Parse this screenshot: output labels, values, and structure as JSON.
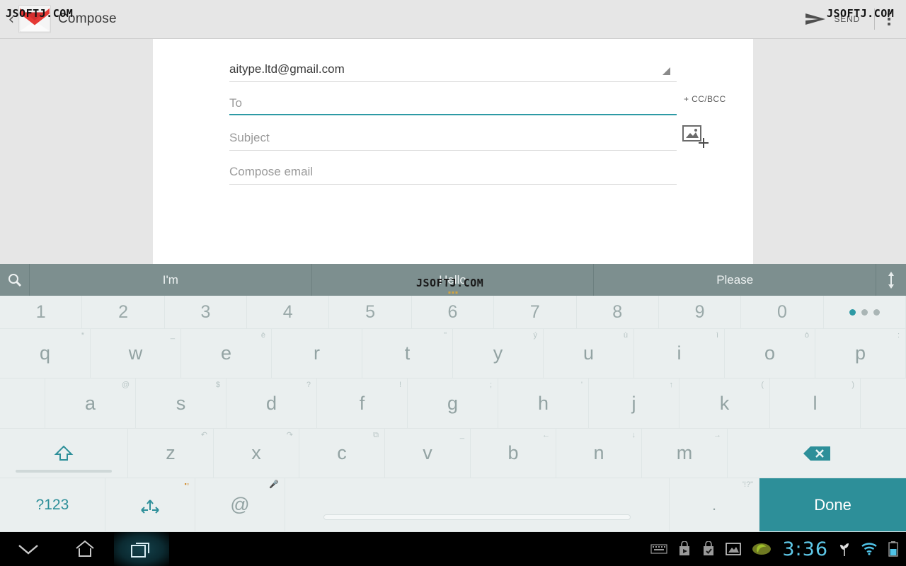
{
  "appbar": {
    "back_icon": "back-chevron-icon",
    "app_icon": "gmail-envelope-icon",
    "title": "Compose",
    "send_icon": "send-paper-plane-icon",
    "send_label": "SEND",
    "overflow_icon": "overflow-menu-icon"
  },
  "compose": {
    "from_value": "aitype.ltd@gmail.com",
    "from_dropdown_icon": "dropdown-caret-icon",
    "to_placeholder": "To",
    "cc_bcc_label": "+ CC/BCC",
    "subject_placeholder": "Subject",
    "body_placeholder": "Compose email",
    "attach_image_icon": "add-image-icon",
    "focus_color": "#2d9aa5"
  },
  "keyboard": {
    "suggestions": {
      "search_icon": "search-icon",
      "items": [
        "I'm",
        "Hello",
        "Please"
      ],
      "expand_icon": "expand-collapse-icon",
      "bar_color": "#7d8f8f"
    },
    "row_numbers": [
      {
        "label": "1"
      },
      {
        "label": "2"
      },
      {
        "label": "3"
      },
      {
        "label": "4"
      },
      {
        "label": "5"
      },
      {
        "label": "6"
      },
      {
        "label": "7"
      },
      {
        "label": "8"
      },
      {
        "label": "9"
      },
      {
        "label": "0"
      }
    ],
    "page_dots": {
      "count": 3,
      "active_index": 0,
      "active_color": "#2d9aa5"
    },
    "row_top": [
      {
        "label": "q",
        "hint": "*"
      },
      {
        "label": "w",
        "hint": "_"
      },
      {
        "label": "e",
        "hint": "è"
      },
      {
        "label": "r",
        "hint": ""
      },
      {
        "label": "t",
        "hint": "\""
      },
      {
        "label": "y",
        "hint": "ý"
      },
      {
        "label": "u",
        "hint": "ù"
      },
      {
        "label": "i",
        "hint": "ì"
      },
      {
        "label": "o",
        "hint": "ò"
      },
      {
        "label": "p",
        "hint": ":"
      }
    ],
    "row_home": [
      {
        "label": "a",
        "hint": "@"
      },
      {
        "label": "s",
        "hint": "$"
      },
      {
        "label": "d",
        "hint": "?"
      },
      {
        "label": "f",
        "hint": "!"
      },
      {
        "label": "g",
        "hint": ";"
      },
      {
        "label": "h",
        "hint": "'"
      },
      {
        "label": "j",
        "hint": "↑"
      },
      {
        "label": "k",
        "hint": "("
      },
      {
        "label": "l",
        "hint": ")"
      }
    ],
    "row_shift": [
      {
        "label": "z",
        "hint": "↶"
      },
      {
        "label": "x",
        "hint": "↷"
      },
      {
        "label": "c",
        "hint": "⧉"
      },
      {
        "label": "v",
        "hint": "_"
      },
      {
        "label": "b",
        "hint": "←"
      },
      {
        "label": "n",
        "hint": "↓"
      },
      {
        "label": "m",
        "hint": "→"
      }
    ],
    "shift_key_icon": "shift-arrow-icon",
    "backspace_key_icon": "backspace-icon",
    "row_bottom": {
      "symbols_label": "?123",
      "language_icon": "arrows-move-icon",
      "language_hint": "emoji-hint-icon",
      "at_label": "@",
      "at_hint": "🎤",
      "space_icon": "space-bar-icon",
      "period_label": ".",
      "period_hint": "'!?\"",
      "done_label": "Done",
      "done_color": "#2d8f99"
    }
  },
  "navbar": {
    "hide_keyboard_icon": "chevron-down-icon",
    "home_icon": "home-icon",
    "recents_icon": "recent-apps-icon",
    "status_icons": [
      "keyboard-icon",
      "play-store-icon",
      "check-bag-icon",
      "image-icon",
      "nvidia-logo-icon",
      "plant-icon",
      "wifi-icon",
      "battery-icon"
    ],
    "clock": "3:36"
  },
  "watermarks": {
    "text": "JSOFTJ.COM"
  }
}
